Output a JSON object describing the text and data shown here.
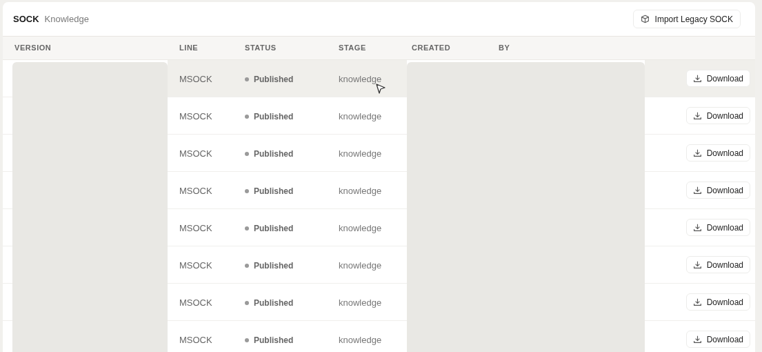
{
  "header": {
    "title": "SOCK",
    "subtitle": "Knowledge",
    "action": "Import Legacy SOCK"
  },
  "table": {
    "columns": [
      "VERSION",
      "LINE",
      "STATUS",
      "STAGE",
      "CREATED",
      "BY"
    ],
    "rows": [
      {
        "line": "MSOCK",
        "status": "Published",
        "stage": "knowledge",
        "action": "Download",
        "hovered": true
      },
      {
        "line": "MSOCK",
        "status": "Published",
        "stage": "knowledge",
        "action": "Download",
        "hovered": false
      },
      {
        "line": "MSOCK",
        "status": "Published",
        "stage": "knowledge",
        "action": "Download",
        "hovered": false
      },
      {
        "line": "MSOCK",
        "status": "Published",
        "stage": "knowledge",
        "action": "Download",
        "hovered": false
      },
      {
        "line": "MSOCK",
        "status": "Published",
        "stage": "knowledge",
        "action": "Download",
        "hovered": false
      },
      {
        "line": "MSOCK",
        "status": "Published",
        "stage": "knowledge",
        "action": "Download",
        "hovered": false
      },
      {
        "line": "MSOCK",
        "status": "Published",
        "stage": "knowledge",
        "action": "Download",
        "hovered": false
      },
      {
        "line": "MSOCK",
        "status": "Published",
        "stage": "knowledge",
        "action": "Download",
        "hovered": false
      }
    ]
  }
}
